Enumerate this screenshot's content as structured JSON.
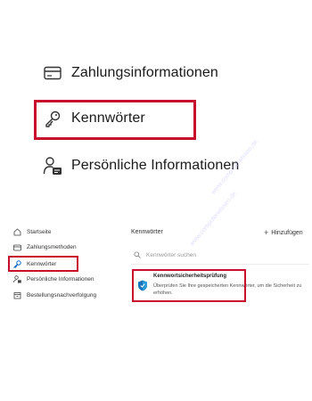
{
  "zoomed_menu": {
    "payment_info": "Zahlungsinformationen",
    "passwords": "Kennwörter",
    "personal_info": "Persönliche Informationen"
  },
  "sidebar": {
    "items": [
      {
        "label": "Startseite",
        "icon": "home-icon"
      },
      {
        "label": "Zahlungsmethoden",
        "icon": "credit-card-icon"
      },
      {
        "label": "Kennwörter",
        "icon": "key-icon"
      },
      {
        "label": "Persönliche Informationen",
        "icon": "person-card-icon"
      },
      {
        "label": "Bestellungsnachverfolgung",
        "icon": "package-icon"
      }
    ]
  },
  "main": {
    "title": "Kennwörter",
    "add_label": "Hinzufügen",
    "search_placeholder": "Kennwörter suchen",
    "card": {
      "title": "Kennwortsicherheitsprüfung",
      "description": "Überprüfen Sie Ihre gespeicherten Kennwörter, um die Sicherheit zu erhöhen."
    }
  },
  "watermark": "www.computerwissen.de",
  "colors": {
    "highlight": "#c8102e",
    "accent": "#0067c0"
  }
}
